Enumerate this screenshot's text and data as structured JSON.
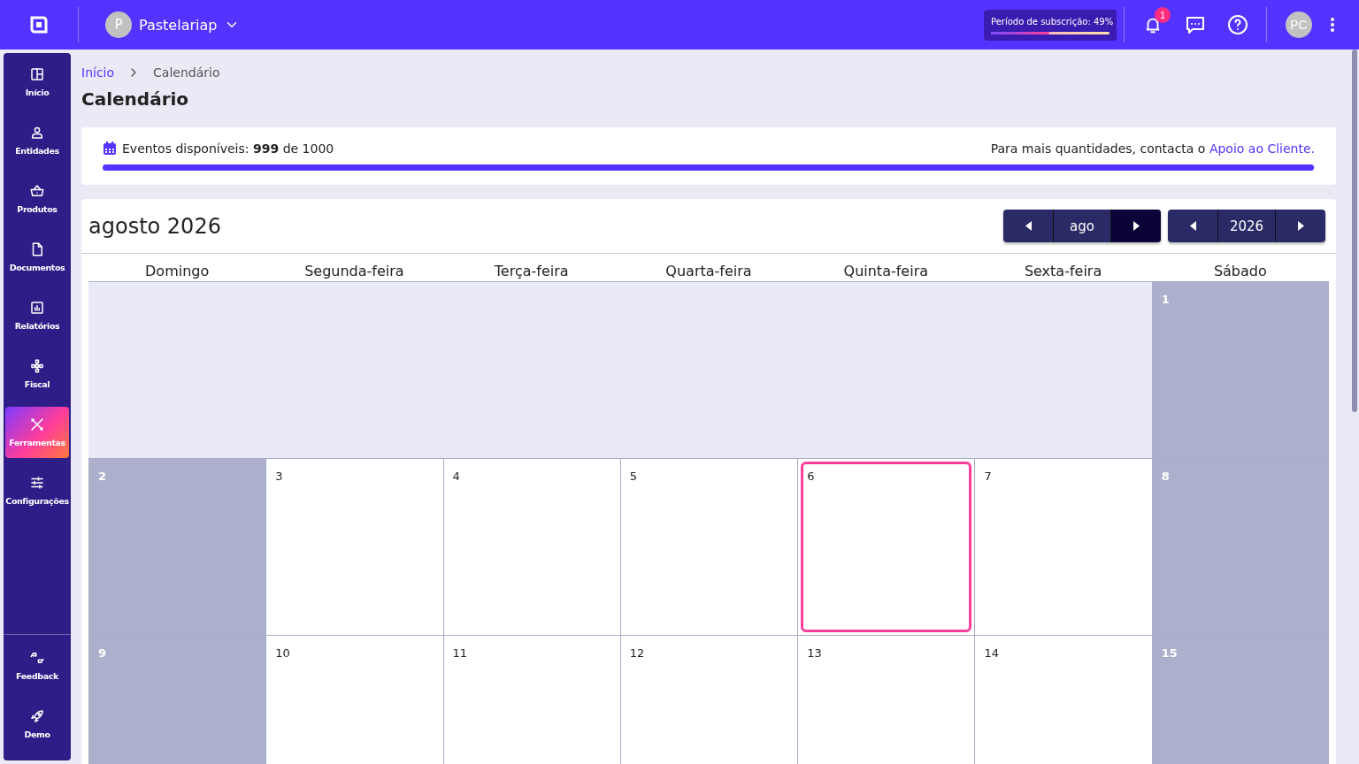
{
  "topbar": {
    "organization": {
      "avatar": "P",
      "name": "Pastelariap"
    },
    "subscription": {
      "label": "Período de subscrição: 49%",
      "level": 0.49
    },
    "notifications": {
      "count": "1"
    },
    "user": {
      "avatar": "PC"
    }
  },
  "sidebar": {
    "items": [
      {
        "label": "Início",
        "selected": false
      },
      {
        "label": "Entidades",
        "selected": false
      },
      {
        "label": "Produtos",
        "selected": false
      },
      {
        "label": "Documentos",
        "selected": false
      },
      {
        "label": "Relatórios",
        "selected": false
      },
      {
        "label": "Fiscal",
        "selected": false
      },
      {
        "label": "Ferramentas",
        "selected": true
      },
      {
        "label": "Configurações",
        "selected": false
      }
    ],
    "bottom_items": [
      {
        "label": "Feedback",
        "selected": false
      },
      {
        "label": "Demo",
        "selected": false
      }
    ]
  },
  "breadcrumb": [
    {
      "label": "Início",
      "kind": "link"
    },
    {
      "label": "Calendário",
      "kind": "current"
    }
  ],
  "page_title": "Calendário",
  "events_quota": {
    "text": "Eventos disponíveis: **999** de 1000",
    "level": 0.999,
    "note": "Para mais quantidades, contacta o",
    "link": "Apoio ao Cliente."
  },
  "calendar": {
    "title": "agosto 2026",
    "month": "ago",
    "year": "2026",
    "weekdays": [
      "Domingo",
      "Segunda-feira",
      "Terça-feira",
      "Quarta-feira",
      "Quinta-feira",
      "Sexta-feira",
      "Sábado"
    ],
    "weeks": [
      [
        {
          "kind": "blank"
        },
        {
          "kind": "blank"
        },
        {
          "kind": "blank"
        },
        {
          "kind": "blank"
        },
        {
          "kind": "blank"
        },
        {
          "kind": "blank"
        },
        {
          "kind": "day",
          "label": "1",
          "weekend": true,
          "selected": false
        }
      ],
      [
        {
          "kind": "day",
          "label": "2",
          "weekend": true,
          "selected": false
        },
        {
          "kind": "day",
          "label": "3",
          "weekend": false,
          "selected": false
        },
        {
          "kind": "day",
          "label": "4",
          "weekend": false,
          "selected": false
        },
        {
          "kind": "day",
          "label": "5",
          "weekend": false,
          "selected": false
        },
        {
          "kind": "day",
          "label": "6",
          "weekend": false,
          "selected": true
        },
        {
          "kind": "day",
          "label": "7",
          "weekend": false,
          "selected": false
        },
        {
          "kind": "day",
          "label": "8",
          "weekend": true,
          "selected": false
        }
      ],
      [
        {
          "kind": "day",
          "label": "9",
          "weekend": true,
          "selected": false
        },
        {
          "kind": "day",
          "label": "10",
          "weekend": false,
          "selected": false
        },
        {
          "kind": "day",
          "label": "11",
          "weekend": false,
          "selected": false
        },
        {
          "kind": "day",
          "label": "12",
          "weekend": false,
          "selected": false
        },
        {
          "kind": "day",
          "label": "13",
          "weekend": false,
          "selected": false
        },
        {
          "kind": "day",
          "label": "14",
          "weekend": false,
          "selected": false
        },
        {
          "kind": "day",
          "label": "15",
          "weekend": true,
          "selected": false
        }
      ]
    ]
  }
}
